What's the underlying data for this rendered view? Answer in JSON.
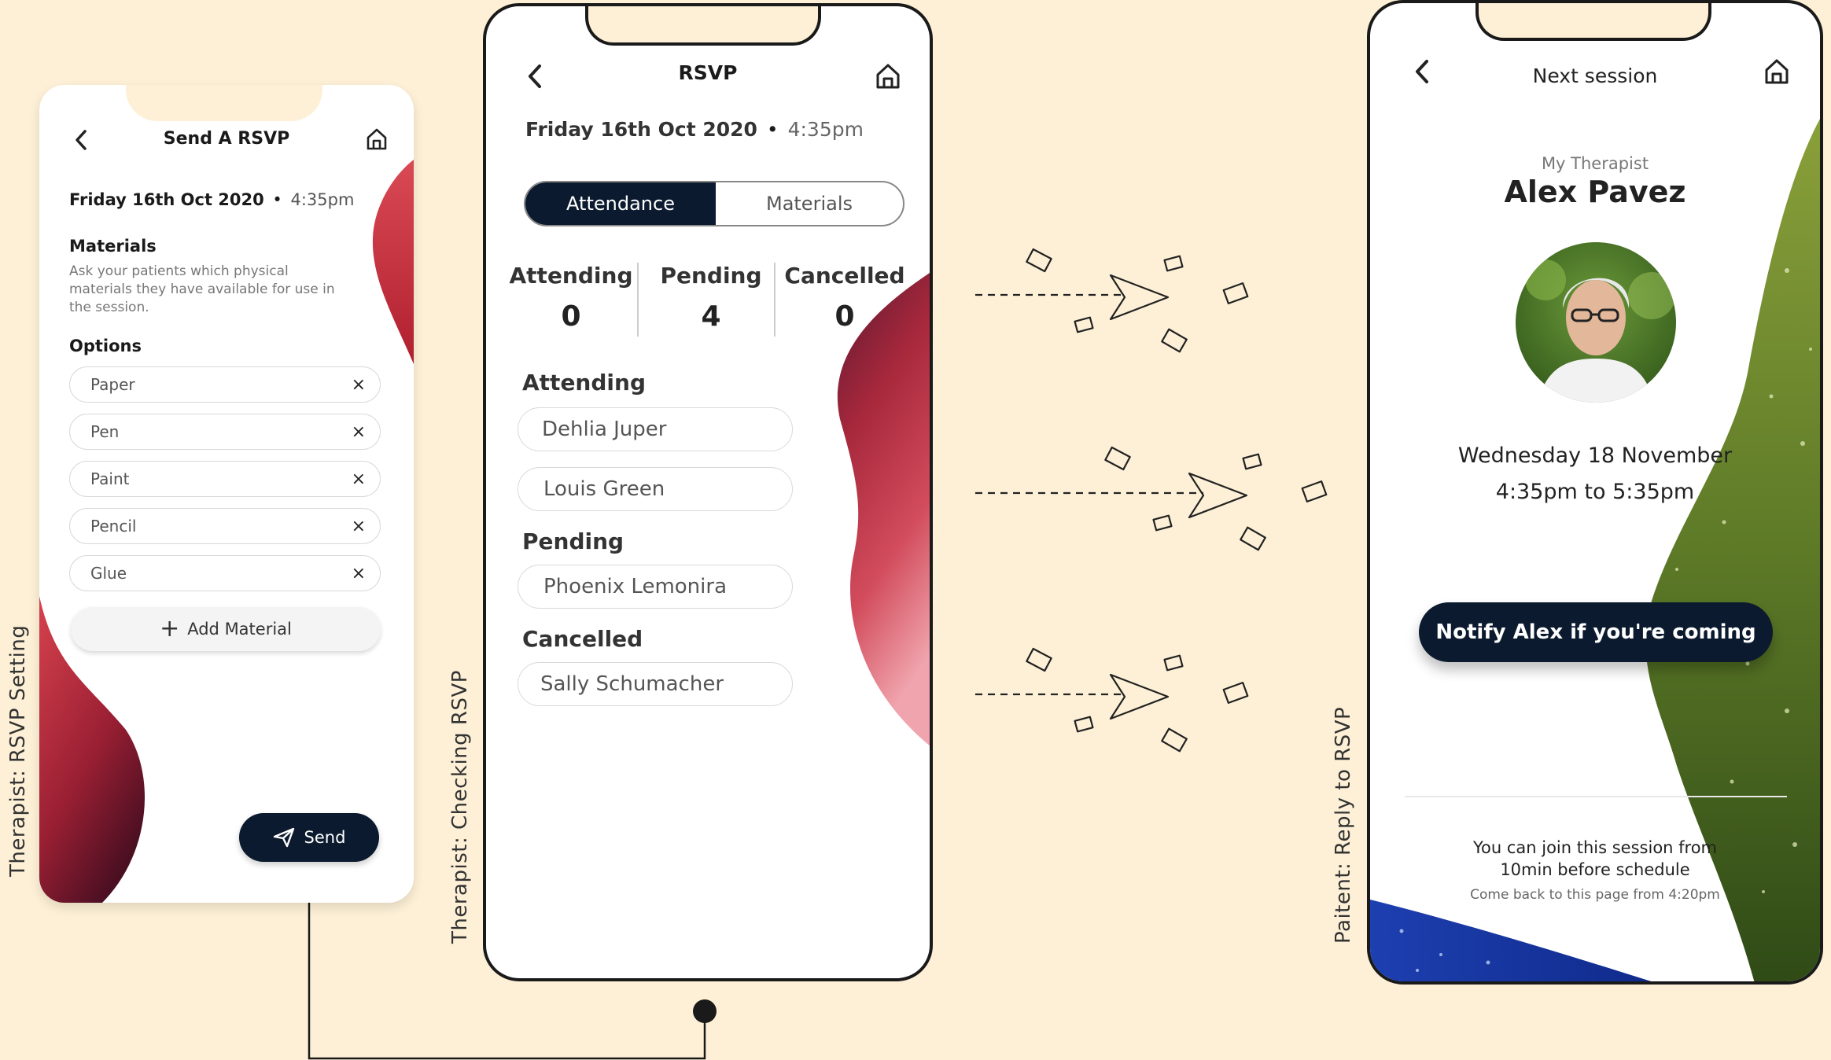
{
  "labels": {
    "screen1": "Therapist: RSVP Setting",
    "screen2": "Therapist: Checking RSVP",
    "screen3": "Paitent: Reply to RSVP"
  },
  "screen1": {
    "title": "Send A RSVP",
    "date": "Friday 16th Oct 2020",
    "separator": "•",
    "time": "4:35pm",
    "materials_heading": "Materials",
    "materials_desc": "Ask your patients which physical materials they have available for use in the session.",
    "options_heading": "Options",
    "options": [
      "Paper",
      "Pen",
      "Paint",
      "Pencil",
      "Glue"
    ],
    "remove_glyph": "×",
    "add_label": "Add Material",
    "add_glyph": "+",
    "send_label": "Send"
  },
  "screen2": {
    "title": "RSVP",
    "date": "Friday 16th Oct 2020",
    "separator": "•",
    "time": "4:35pm",
    "tabs": [
      "Attendance",
      "Materials"
    ],
    "stats": [
      {
        "label": "Attending",
        "value": "0"
      },
      {
        "label": "Pending",
        "value": "4"
      },
      {
        "label": "Cancelled",
        "value": "0"
      }
    ],
    "attending_heading": "Attending",
    "attending": [
      "Dehlia Juper",
      "Louis Green"
    ],
    "pending_heading": "Pending",
    "pending": [
      "Phoenix Lemonira"
    ],
    "cancelled_heading": "Cancelled",
    "cancelled": [
      "Sally Schumacher"
    ]
  },
  "screen3": {
    "title": "Next session",
    "therapist_label": "My Therapist",
    "therapist_name": "Alex Pavez",
    "date": "Wednesday 18 November",
    "time_range": "4:35pm to 5:35pm",
    "notify_label": "Notify Alex if you're coming",
    "join_info": "You can join this session from 10min before schedule",
    "come_back": "Come back to this page from 4:20pm"
  },
  "colors": {
    "navy": "#0b1a2e",
    "red": "#c2303a",
    "green": "#5c7a2a",
    "blue": "#1a3aa8",
    "background": "#fdf0d6"
  }
}
